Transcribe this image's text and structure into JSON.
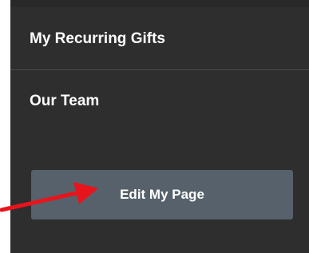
{
  "menu": {
    "items": [
      {
        "label": "My Recurring Gifts"
      },
      {
        "label": "Our Team"
      }
    ],
    "edit_button_label": "Edit My Page"
  },
  "annotation": {
    "arrow_color": "#e8141b"
  }
}
